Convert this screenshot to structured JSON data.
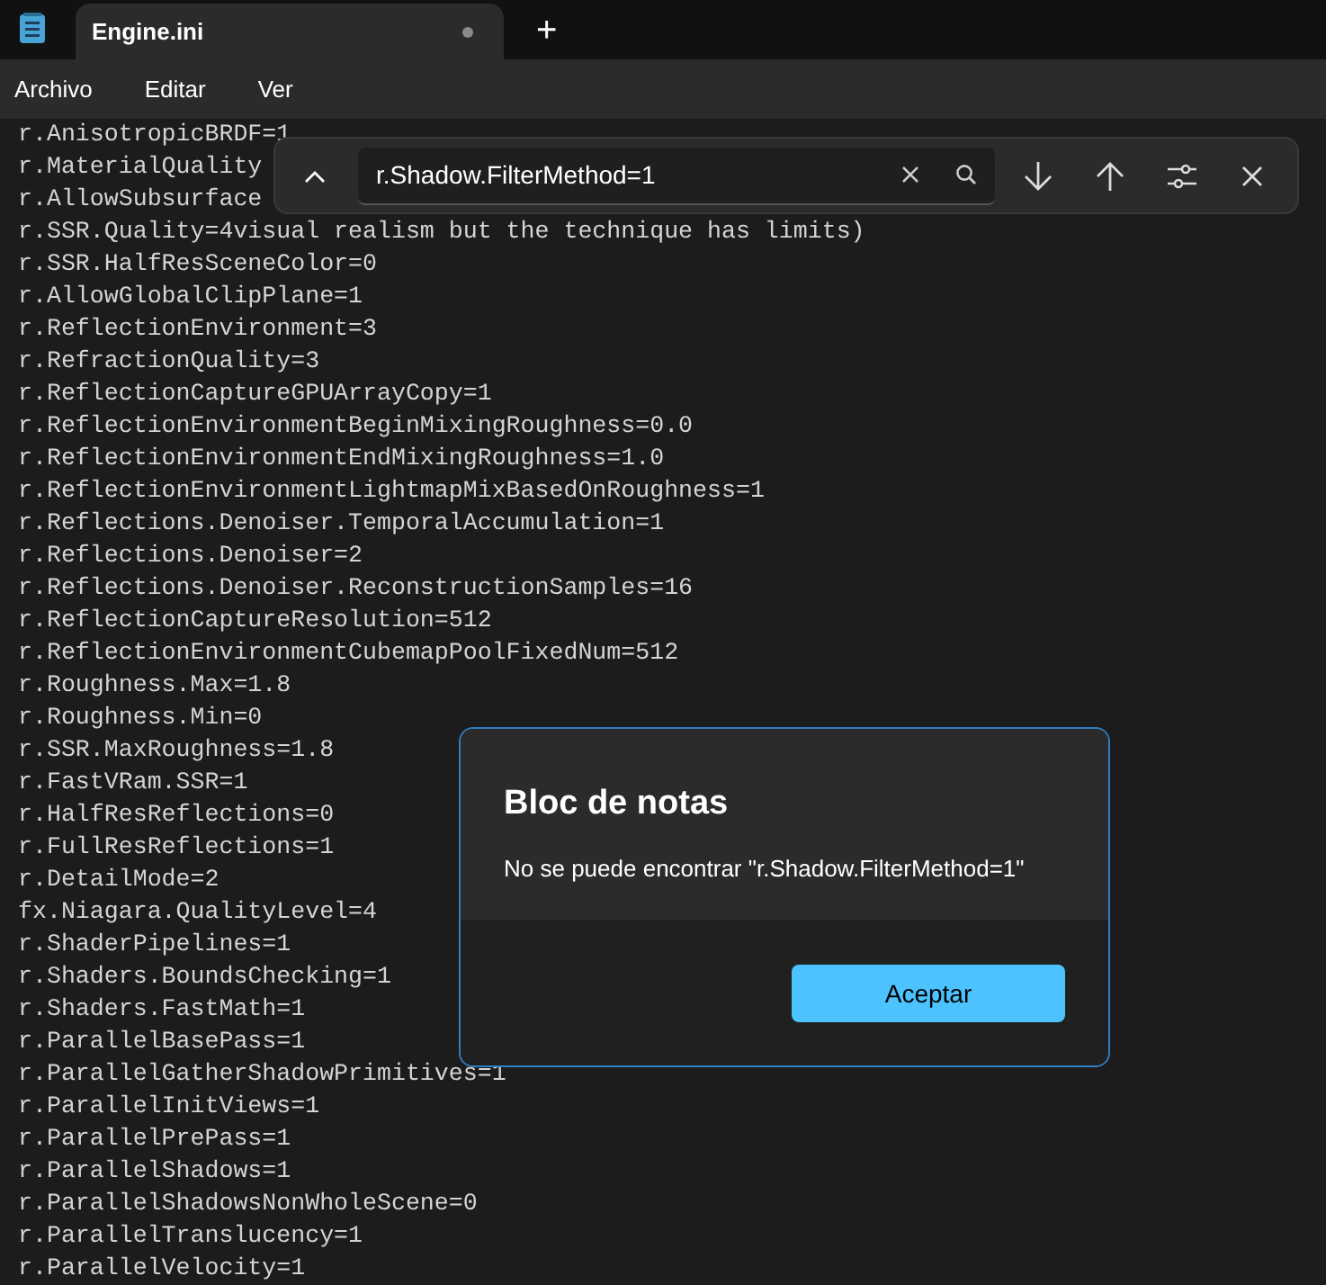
{
  "tab": {
    "title": "Engine.ini",
    "modified": true
  },
  "new_tab": "+",
  "menu": [
    "Archivo",
    "Editar",
    "Ver"
  ],
  "editor": {
    "lines": [
      "r.AnisotropicBRDF=1",
      "r.MaterialQuality",
      "r.AllowSubsurface",
      "r.SSR.Quality=4visual realism but the technique has limits)",
      "r.SSR.HalfResSceneColor=0",
      "r.AllowGlobalClipPlane=1",
      "r.ReflectionEnvironment=3",
      "r.RefractionQuality=3",
      "r.ReflectionCaptureGPUArrayCopy=1",
      "r.ReflectionEnvironmentBeginMixingRoughness=0.0",
      "r.ReflectionEnvironmentEndMixingRoughness=1.0",
      "r.ReflectionEnvironmentLightmapMixBasedOnRoughness=1",
      "r.Reflections.Denoiser.TemporalAccumulation=1",
      "r.Reflections.Denoiser=2",
      "r.Reflections.Denoiser.ReconstructionSamples=16",
      "r.ReflectionCaptureResolution=512",
      "r.ReflectionEnvironmentCubemapPoolFixedNum=512",
      "r.Roughness.Max=1.8",
      "r.Roughness.Min=0",
      "r.SSR.MaxRoughness=1.8",
      "r.FastVRam.SSR=1",
      "r.HalfResReflections=0",
      "r.FullResReflections=1",
      "r.DetailMode=2",
      "fx.Niagara.QualityLevel=4",
      "r.ShaderPipelines=1",
      "r.Shaders.BoundsChecking=1",
      "r.Shaders.FastMath=1",
      "r.ParallelBasePass=1",
      "r.ParallelGatherShadowPrimitives=1",
      "r.ParallelInitViews=1",
      "r.ParallelPrePass=1",
      "r.ParallelShadows=1",
      "r.ParallelShadowsNonWholeScene=0",
      "r.ParallelTranslucency=1",
      "r.ParallelVelocity=1"
    ]
  },
  "find_bar": {
    "query": "r.Shadow.FilterMethod=1"
  },
  "dialog": {
    "title": "Bloc de notas",
    "message": "No se puede encontrar \"r.Shadow.FilterMethod=1\"",
    "button": "Aceptar"
  }
}
